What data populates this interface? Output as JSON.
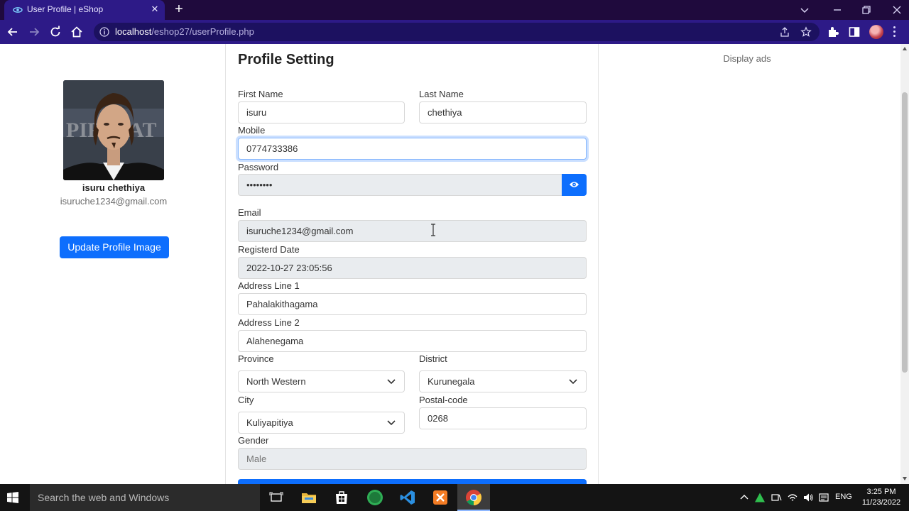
{
  "browser": {
    "tab_title": "User Profile | eShop",
    "close_glyph": "✕",
    "new_tab_glyph": "+",
    "url_host": "localhost",
    "url_path": "/eshop27/userProfile.php"
  },
  "sidebar": {
    "user_name": "isuru chethiya",
    "user_email": "isuruche1234@gmail.com",
    "update_image_label": "Update Profile Image"
  },
  "form": {
    "title": "Profile Setting",
    "first_name": {
      "label": "First Name",
      "value": "isuru"
    },
    "last_name": {
      "label": "Last Name",
      "value": "chethiya"
    },
    "mobile": {
      "label": "Mobile",
      "value": "0774733386"
    },
    "password": {
      "label": "Password",
      "value": "••••••••"
    },
    "email": {
      "label": "Email",
      "value": "isuruche1234@gmail.com"
    },
    "registered_date": {
      "label": "Registerd Date",
      "value": "2022-10-27 23:05:56"
    },
    "address_line1": {
      "label": "Address Line 1",
      "value": "Pahalakithagama"
    },
    "address_line2": {
      "label": "Address Line 2",
      "value": "Alahenegama"
    },
    "province": {
      "label": "Province",
      "value": "North Western"
    },
    "district": {
      "label": "District",
      "value": "Kurunegala"
    },
    "city": {
      "label": "City",
      "value": "Kuliyapitiya"
    },
    "postal_code": {
      "label": "Postal-code",
      "value": "0268"
    },
    "gender": {
      "label": "Gender",
      "value": "Male"
    }
  },
  "ads": {
    "label": "Display ads"
  },
  "taskbar": {
    "search_placeholder": "Search the web and Windows",
    "language": "ENG",
    "time": "3:25 PM",
    "date": "11/23/2022"
  },
  "colors": {
    "primary": "#0d6efd",
    "browser_frame": "#2d1a87",
    "tab_strip": "#1f0a3d",
    "disabled_field": "#e9ecef"
  },
  "icons": {
    "taskbar_apps": [
      "task-view-icon",
      "file-explorer-icon",
      "store-icon",
      "hs-app-icon",
      "vscode-icon",
      "xampp-icon",
      "chrome-icon"
    ]
  }
}
